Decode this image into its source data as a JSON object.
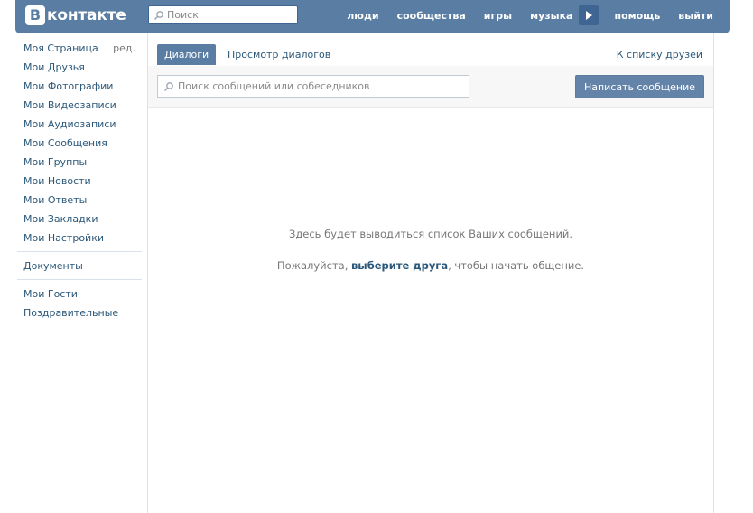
{
  "header": {
    "logo_letter": "В",
    "logo_text": "контакте",
    "search_placeholder": "Поиск",
    "nav": {
      "people": "люди",
      "communities": "сообщества",
      "games": "игры",
      "music": "музыка",
      "help": "помощь",
      "logout": "выйти"
    },
    "play_icon": "play-icon"
  },
  "sidebar": {
    "my_page": "Моя Страница",
    "edit": "ред.",
    "items_main": [
      "Мои Друзья",
      "Мои Фотографии",
      "Мои Видеозаписи",
      "Мои Аудиозаписи",
      "Мои Сообщения",
      "Мои Группы",
      "Мои Новости",
      "Мои Ответы",
      "Мои Закладки",
      "Мои Настройки"
    ],
    "documents": "Документы",
    "guests": "Мои Гости",
    "greetings": "Поздравительные"
  },
  "tabs": {
    "dialogs": "Диалоги",
    "view_dialogs": "Просмотр диалогов",
    "friends_list": "К списку друзей"
  },
  "toolbar": {
    "search_placeholder": "Поиск сообщений или собеседников",
    "compose": "Написать сообщение"
  },
  "empty": {
    "line1": "Здесь будет выводиться список Ваших сообщений.",
    "line2_before": "Пожалуйста, ",
    "line2_link": "выберите друга",
    "line2_after": ", чтобы начать общение."
  },
  "colors": {
    "header_bg": "#597da3",
    "link": "#2b587a",
    "button_bg": "#6383a8"
  }
}
